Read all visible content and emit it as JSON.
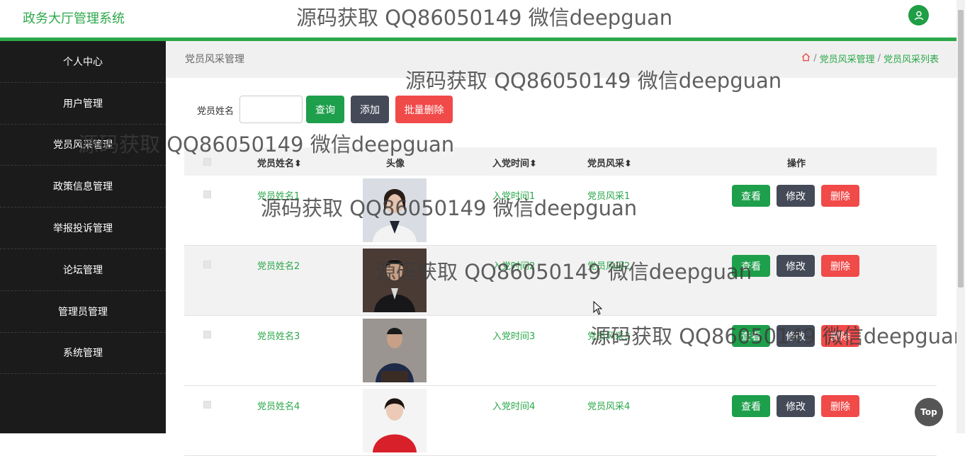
{
  "app": {
    "title": "政务大厅管理系统"
  },
  "watermark": {
    "text": "源码获取 QQ86050149 微信deepguan"
  },
  "sidebar": {
    "items": [
      {
        "label": "个人中心"
      },
      {
        "label": "用户管理"
      },
      {
        "label": "党员风采管理"
      },
      {
        "label": "政策信息管理"
      },
      {
        "label": "举报投诉管理"
      },
      {
        "label": "论坛管理"
      },
      {
        "label": "管理员管理"
      },
      {
        "label": "系统管理"
      }
    ]
  },
  "page": {
    "title": "党员风采管理",
    "breadcrumbs": [
      "党员风采管理",
      "党员风采列表"
    ]
  },
  "search": {
    "label": "党员姓名",
    "value": "",
    "query_button": "查询",
    "add_button": "添加",
    "batch_delete_button": "批量删除"
  },
  "table": {
    "headers": {
      "name": "党员姓名",
      "avatar": "头像",
      "join_time": "入党时间",
      "style": "党员风采",
      "actions": "操作"
    },
    "row_actions": {
      "view": "查看",
      "edit": "修改",
      "delete": "删除"
    },
    "rows": [
      {
        "name": "党员姓名1",
        "join_time": "入党时间1",
        "style": "党员风采1"
      },
      {
        "name": "党员姓名2",
        "join_time": "入党时间2",
        "style": "党员风采2"
      },
      {
        "name": "党员姓名3",
        "join_time": "入党时间3",
        "style": "党员风采3"
      },
      {
        "name": "党员姓名4",
        "join_time": "入党时间4",
        "style": "党员风采4"
      }
    ]
  },
  "back_to_top": {
    "label": "Top"
  },
  "colors": {
    "accent": "#2ba84a",
    "danger": "#f04a49",
    "dark": "#444a58",
    "sidebar": "#1b1b1b"
  }
}
